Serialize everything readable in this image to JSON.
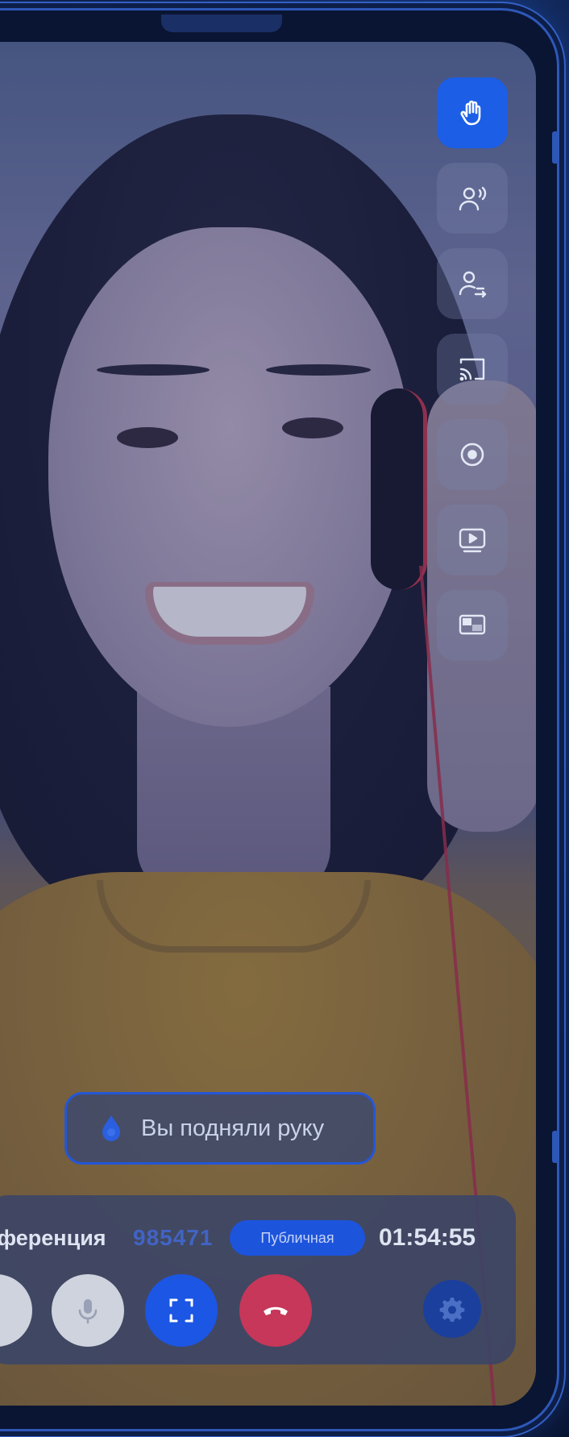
{
  "toolbar": {
    "buttons": [
      {
        "icon": "raise-hand-icon",
        "active": true
      },
      {
        "icon": "speaking-user-icon",
        "active": false
      },
      {
        "icon": "user-share-icon",
        "active": false
      },
      {
        "icon": "cast-icon",
        "active": false
      },
      {
        "icon": "record-icon",
        "active": false
      },
      {
        "icon": "youtube-stream-icon",
        "active": false
      },
      {
        "icon": "picture-in-picture-icon",
        "active": false
      }
    ]
  },
  "toast": {
    "text": "Вы подняли руку",
    "icon": "hand-drop-icon"
  },
  "call_panel": {
    "label": "оференция",
    "conference_id": "985471",
    "badge": "Публичная",
    "timer": "01:54:55",
    "controls": [
      "speaker-icon",
      "microphone-icon",
      "fullscreen-icon",
      "end-call-icon",
      "settings-icon"
    ]
  },
  "colors": {
    "accent": "#1c5ee6",
    "end_call": "#c6375a",
    "panel": "#3a4468",
    "frame": "#2d58b8"
  }
}
